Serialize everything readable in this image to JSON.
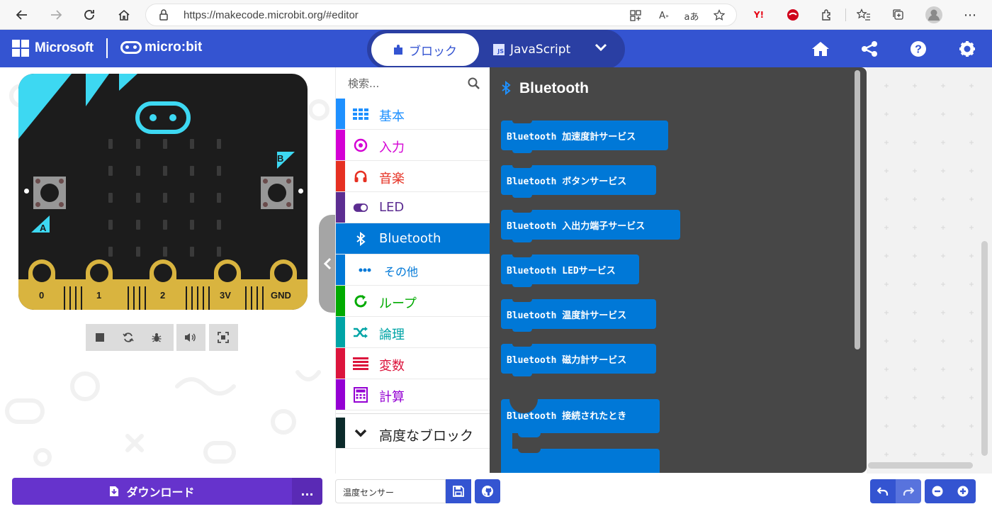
{
  "browser": {
    "url": "https://makecode.microbit.org/#editor"
  },
  "header": {
    "brand": "Microsoft",
    "product": "micro:bit",
    "tab_blocks": "ブロック",
    "tab_js": "JavaScript",
    "js_badge": "JS"
  },
  "simulator": {
    "button_a": "A",
    "button_b": "B",
    "pins": [
      "0",
      "1",
      "2",
      "3V",
      "GND"
    ]
  },
  "toolbox": {
    "search_placeholder": "検索...",
    "categories": [
      {
        "label": "基本",
        "color": "#1e90ff"
      },
      {
        "label": "入力",
        "color": "#d400d4"
      },
      {
        "label": "音楽",
        "color": "#e63022"
      },
      {
        "label": "LED",
        "color": "#5c2d91"
      },
      {
        "label": "Bluetooth",
        "color": "#0078d7"
      },
      {
        "label": "その他",
        "color": "#0078d7"
      },
      {
        "label": "ループ",
        "color": "#00aa00"
      },
      {
        "label": "論理",
        "color": "#00a4a6"
      },
      {
        "label": "変数",
        "color": "#dc143c"
      },
      {
        "label": "計算",
        "color": "#9400d3"
      },
      {
        "label": "高度なブロック",
        "color": "#222222"
      }
    ]
  },
  "flyout": {
    "title": "Bluetooth",
    "blocks": [
      "Bluetooth 加速度計サービス",
      "Bluetooth ボタンサービス",
      "Bluetooth 入出力端子サービス",
      "Bluetooth LEDサービス",
      "Bluetooth 温度計サービス",
      "Bluetooth 磁力計サービス",
      "Bluetooth 接続されたとき"
    ]
  },
  "bottom": {
    "download_label": "ダウンロード",
    "more_label": "...",
    "project_name": "温度センサー"
  }
}
